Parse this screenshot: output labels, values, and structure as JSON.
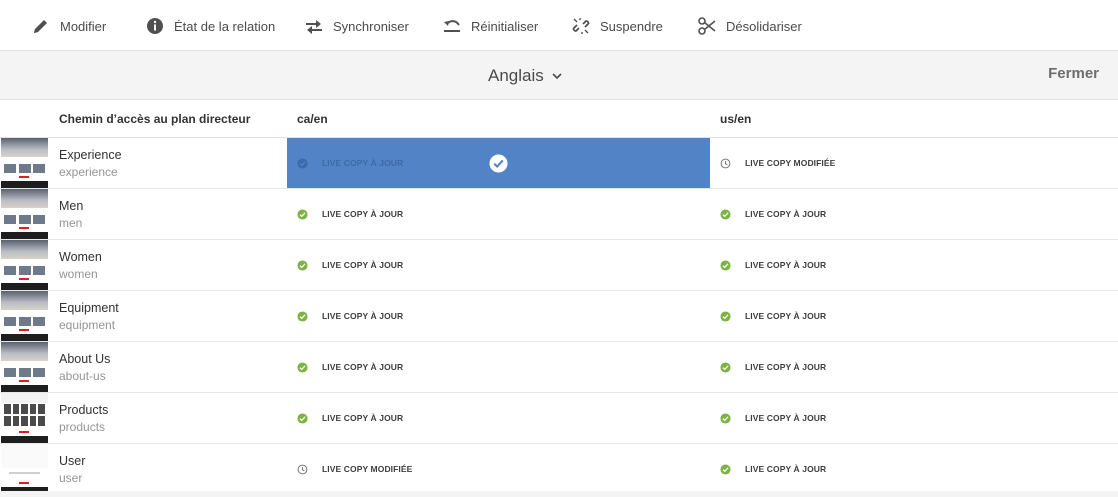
{
  "toolbar": {
    "items": [
      {
        "label": "Modifier",
        "icon": "pencil-icon"
      },
      {
        "label": "État de la relation",
        "icon": "info-icon"
      },
      {
        "label": "Synchroniser",
        "icon": "sync-icon"
      },
      {
        "label": "Réinitialiser",
        "icon": "reset-icon"
      },
      {
        "label": "Suspendre",
        "icon": "suspend-link-icon"
      },
      {
        "label": "Désolidariser",
        "icon": "scissors-icon"
      }
    ]
  },
  "language_bar": {
    "selected_language": "Anglais",
    "close_label": "Fermer"
  },
  "table": {
    "columns": [
      "Chemin d’accès au plan directeur",
      "ca/en",
      "us/en"
    ],
    "rows": [
      {
        "title": "Experience",
        "path": "experience",
        "thumb": "experience",
        "ca": "LIVE COPY À JOUR",
        "ca_state": "ok",
        "ca_selected": true,
        "us": "LIVE COPY MODIFIÉE",
        "us_state": "modified"
      },
      {
        "title": "Men",
        "path": "men",
        "thumb": "men",
        "ca": "LIVE COPY À JOUR",
        "ca_state": "ok",
        "us": "LIVE COPY À JOUR",
        "us_state": "ok"
      },
      {
        "title": "Women",
        "path": "women",
        "thumb": "women",
        "ca": "LIVE COPY À JOUR",
        "ca_state": "ok",
        "us": "LIVE COPY À JOUR",
        "us_state": "ok"
      },
      {
        "title": "Equipment",
        "path": "equipment",
        "thumb": "equipment",
        "ca": "LIVE COPY À JOUR",
        "ca_state": "ok",
        "us": "LIVE COPY À JOUR",
        "us_state": "ok"
      },
      {
        "title": "About Us",
        "path": "about-us",
        "thumb": "about-us",
        "ca": "LIVE COPY À JOUR",
        "ca_state": "ok",
        "us": "LIVE COPY À JOUR",
        "us_state": "ok"
      },
      {
        "title": "Products",
        "path": "products",
        "thumb": "products",
        "ca": "LIVE COPY À JOUR",
        "ca_state": "ok",
        "us": "LIVE COPY À JOUR",
        "us_state": "ok"
      },
      {
        "title": "User",
        "path": "user",
        "thumb": "user",
        "ca": "LIVE COPY MODIFIÉE",
        "ca_state": "modified",
        "us": "LIVE COPY À JOUR",
        "us_state": "ok"
      }
    ]
  },
  "colors": {
    "selection": "#5283c6",
    "ok_green": "#7cb342",
    "modified_gray": "#7a7a7a",
    "header_bg": "#f4f4f4"
  }
}
